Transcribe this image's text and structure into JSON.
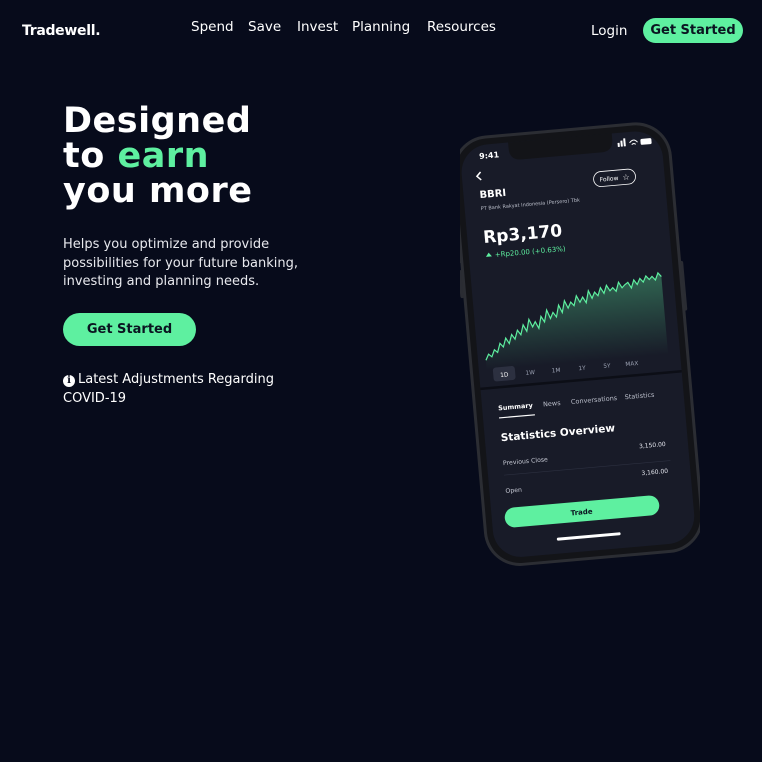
{
  "brand": {
    "logo": "Tradewell."
  },
  "nav": {
    "items": [
      {
        "label": "Spend"
      },
      {
        "label": "Save"
      },
      {
        "label": "Invest"
      },
      {
        "label": "Planning"
      },
      {
        "label": "Resources"
      }
    ],
    "login_label": "Login",
    "cta_label": "Get Started"
  },
  "hero": {
    "title_line1": "Designed",
    "title_line2_prefix": "to ",
    "title_line2_accent": "earn",
    "title_line3": "you more",
    "subtitle": "Helps you optimize and provide possibilities for your future banking, investing and planning needs.",
    "cta_label": "Get Started",
    "notice": "Latest Adjustments Regarding COVID-19"
  },
  "colors": {
    "background": "#070b1b",
    "accent": "#5ef0a0",
    "text": "#ffffff"
  },
  "phone": {
    "time": "9:41",
    "ticker": "BBRI",
    "company": "PT Bank Rakyat Indonesia (Persero) Tbk",
    "follow_label": "Follow",
    "price": "Rp3,170",
    "change": "+Rp20.00 (+0.63%)",
    "ranges": [
      "1D",
      "1W",
      "1M",
      "1Y",
      "5Y",
      "MAX"
    ],
    "selected_range": "1D",
    "tabs": [
      "Summary",
      "News",
      "Conversations",
      "Statistics"
    ],
    "active_tab": "Summary",
    "stats_title": "Statistics Overview",
    "stats": [
      {
        "label": "Previous Close",
        "value": "3,150.00"
      },
      {
        "label": "Open",
        "value": "3,160.00"
      }
    ],
    "trade_label": "Trade",
    "chart_series": [
      12,
      18,
      15,
      22,
      19,
      28,
      24,
      33,
      27,
      36,
      31,
      40,
      35,
      45,
      38,
      50,
      42,
      47,
      40,
      52,
      46,
      58,
      49,
      55,
      50,
      62,
      54,
      66,
      58,
      64,
      60,
      70,
      63,
      68,
      62,
      74,
      66,
      72,
      68,
      76,
      70,
      78,
      72,
      75,
      71,
      80,
      74,
      77,
      79,
      73,
      81,
      76,
      82,
      78,
      84,
      80,
      83,
      79,
      86,
      82
    ]
  },
  "chart_data": {
    "type": "line",
    "series": [
      {
        "values": [
          12,
          18,
          15,
          22,
          19,
          28,
          24,
          33,
          27,
          36,
          31,
          40,
          35,
          45,
          38,
          50,
          42,
          47,
          40,
          52,
          46,
          58,
          49,
          55,
          50,
          62,
          54,
          66,
          58,
          64,
          60,
          70,
          63,
          68,
          62,
          74,
          66,
          72,
          68,
          76,
          70,
          78,
          72,
          75,
          71,
          80,
          74,
          77,
          79,
          73,
          81,
          76,
          82,
          78,
          84,
          80,
          83,
          79,
          86,
          82
        ]
      }
    ]
  }
}
